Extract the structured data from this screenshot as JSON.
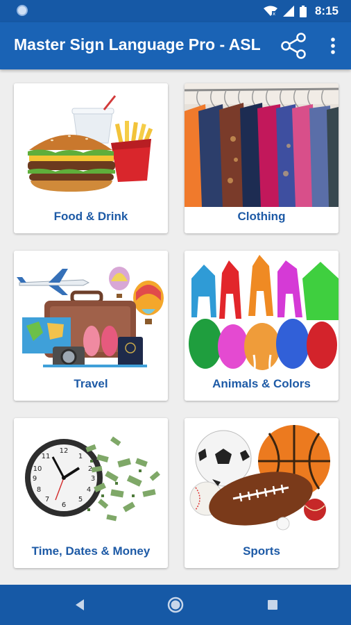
{
  "status_bar": {
    "time": "8:15",
    "icons": [
      "notification-dot-icon",
      "wifi-icon",
      "cell-signal-icon",
      "battery-icon"
    ]
  },
  "app_bar": {
    "title": "Master Sign Language Pro - ASL",
    "actions": [
      "share-icon",
      "more-vert-icon"
    ]
  },
  "categories": [
    {
      "label": "Food & Drink",
      "image": "burger-fries-drink-image"
    },
    {
      "label": "Clothing",
      "image": "clothes-rack-image"
    },
    {
      "label": "Travel",
      "image": "travel-suitcase-image"
    },
    {
      "label": "Animals & Colors",
      "image": "colored-animals-image"
    },
    {
      "label": "Time, Dates & Money",
      "image": "clock-money-image"
    },
    {
      "label": "Sports",
      "image": "sports-balls-image"
    }
  ],
  "nav_bar": {
    "buttons": [
      "back-icon",
      "home-icon",
      "recents-icon"
    ]
  },
  "colors": {
    "primary": "#1a63b5",
    "primary_dark": "#1659a6",
    "label": "#1d5aa6",
    "background": "#eeeeee"
  }
}
